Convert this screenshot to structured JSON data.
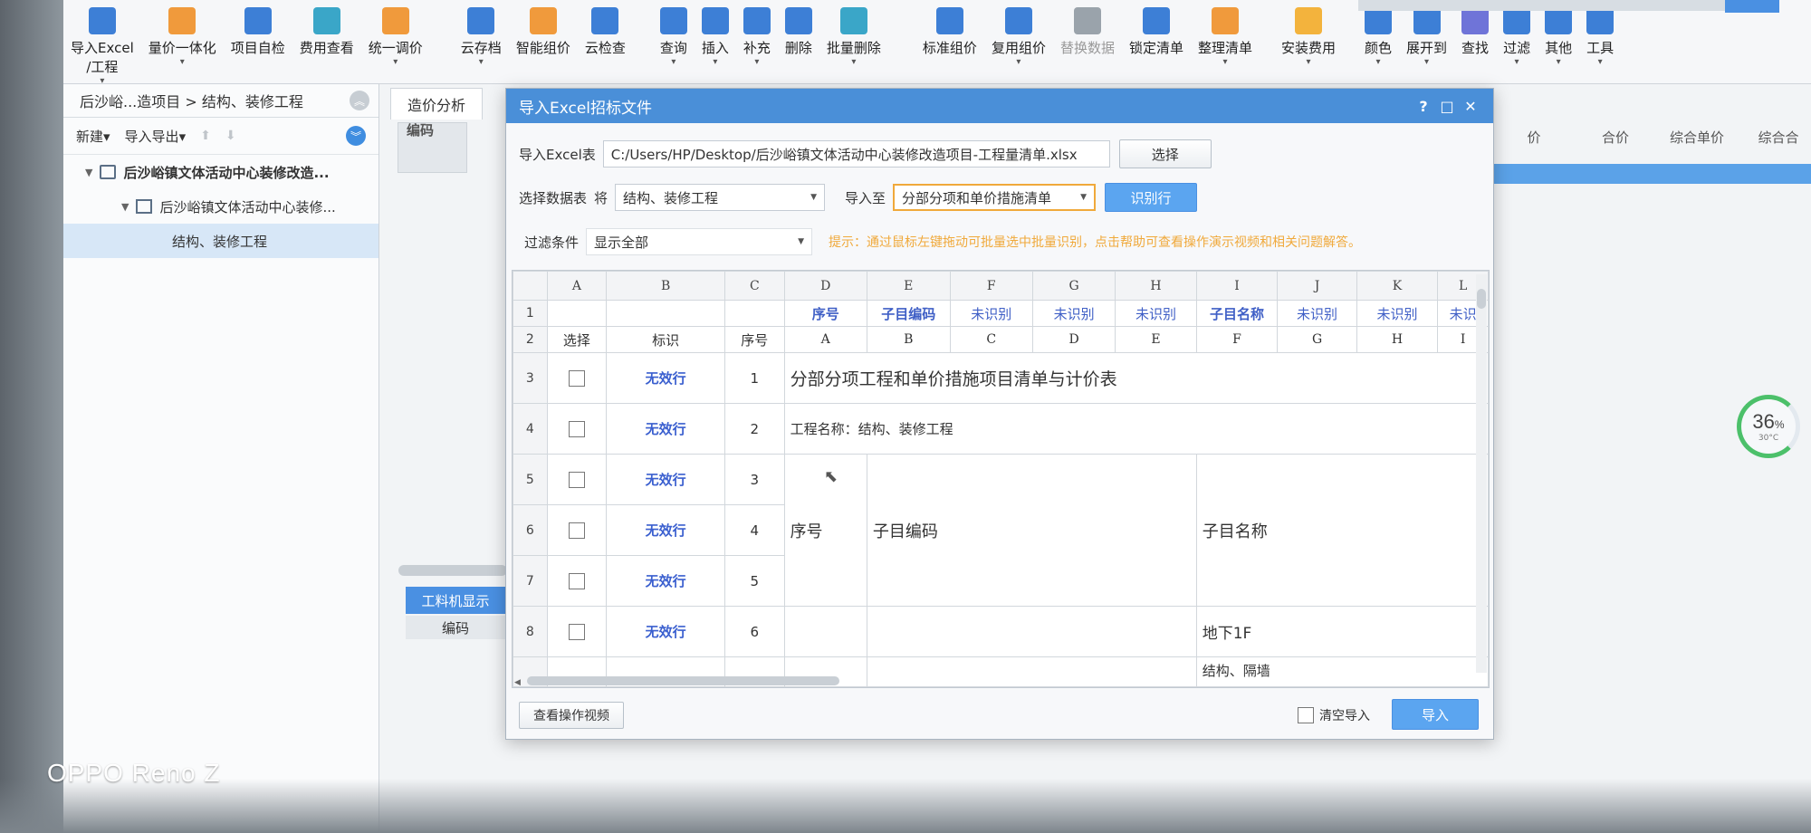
{
  "ribbon": {
    "items": [
      {
        "label": "导入Excel",
        "label2": "/工程",
        "icon": "excel-import-icon",
        "arrow": true
      },
      {
        "label": "量价一体化",
        "icon": "calc-icon",
        "arrow": true
      },
      {
        "label": "项目自检",
        "icon": "check-icon"
      },
      {
        "label": "费用查看",
        "icon": "fee-view-icon"
      },
      {
        "label": "统一调价",
        "icon": "adjust-price-icon",
        "arrow": true
      },
      {
        "label": "云存档",
        "icon": "cloud-save-icon",
        "arrow": true
      },
      {
        "label": "智能组价",
        "icon": "smart-price-icon"
      },
      {
        "label": "云检查",
        "icon": "cloud-check-icon"
      },
      {
        "label": "查询",
        "icon": "query-icon",
        "arrow": true
      },
      {
        "label": "插入",
        "icon": "insert-icon",
        "arrow": true
      },
      {
        "label": "补充",
        "icon": "supplement-icon",
        "arrow": true
      },
      {
        "label": "删除",
        "icon": "delete-icon"
      },
      {
        "label": "批量删除",
        "icon": "batch-delete-icon",
        "arrow": true
      },
      {
        "label": "标准组价",
        "icon": "standard-price-icon"
      },
      {
        "label": "复用组价",
        "icon": "reuse-price-icon",
        "arrow": true
      },
      {
        "label": "替换数据",
        "icon": "replace-data-icon",
        "dim": true
      },
      {
        "label": "锁定清单",
        "icon": "lock-icon"
      },
      {
        "label": "整理清单",
        "icon": "organize-icon",
        "arrow": true
      },
      {
        "label": "安装费用",
        "icon": "install-fee-icon",
        "arrow": true
      },
      {
        "label": "颜色",
        "icon": "color-icon",
        "arrow": true
      },
      {
        "label": "展开到",
        "icon": "expand-icon",
        "arrow": true
      },
      {
        "label": "查找",
        "icon": "find-icon"
      },
      {
        "label": "过滤",
        "icon": "filter-icon",
        "arrow": true
      },
      {
        "label": "其他",
        "icon": "other-icon",
        "arrow": true
      },
      {
        "label": "工具",
        "icon": "tools-icon",
        "arrow": true
      }
    ]
  },
  "left": {
    "breadcrumb": "后沙峪...造项目 > 结构、装修工程",
    "new_label": "新建",
    "import_export_label": "导入导出",
    "tree": [
      {
        "level": 0,
        "text": "后沙峪镇文体活动中心装修改造..."
      },
      {
        "level": 1,
        "text": "后沙峪镇文体活动中心装修..."
      },
      {
        "level": 2,
        "text": "结构、装修工程"
      }
    ]
  },
  "center": {
    "tab": "造价分析",
    "col_header": "编码",
    "right_cols": [
      "价",
      "合价",
      "综合单价",
      "综合合"
    ],
    "bottom_tab_active": "工料机显示",
    "bottom_col": "编码"
  },
  "gauge": {
    "percent": "36",
    "unit": "%",
    "temp": "30°C"
  },
  "dialog": {
    "title": "导入Excel招标文件",
    "controls": {
      "help": "?",
      "max": "□",
      "close": "✕"
    },
    "excel_label": "导入Excel表",
    "excel_path": "C:/Users/HP/Desktop/后沙峪镇文体活动中心装修改造项目-工程量清单.xlsx",
    "choose_button": "选择",
    "sheet_label": "选择数据表",
    "sheet_prefix": "将",
    "sheet_value": "结构、装修工程",
    "import_to_label": "导入至",
    "import_to_value": "分部分项和单价措施清单",
    "identify_button": "识别行",
    "filter_label": "过滤条件",
    "filter_value": "显示全部",
    "hint": "提示：通过鼠标左键拖动可批量选中批量识别，点击帮助可查看操作演示视频和相关问题解答。",
    "grid": {
      "col_letters": [
        "A",
        "B",
        "C",
        "D",
        "E",
        "F",
        "G",
        "H",
        "I",
        "J",
        "K",
        "L"
      ],
      "row1": [
        "",
        "",
        "",
        "序号",
        "子目编码",
        "未识别",
        "未识别",
        "未识别",
        "子目名称",
        "未识别",
        "未识别",
        "未识"
      ],
      "row2": [
        "选择",
        "标识",
        "序号",
        "A",
        "B",
        "C",
        "D",
        "E",
        "F",
        "G",
        "H",
        "I"
      ],
      "rows": [
        {
          "rn": "3",
          "flag": "无效行",
          "seq": "1",
          "text": "分部分项工程和单价措施项目清单与计价表"
        },
        {
          "rn": "4",
          "flag": "无效行",
          "seq": "2",
          "text": "工程名称：结构、装修工程"
        },
        {
          "rn": "5",
          "flag": "无效行",
          "seq": "3"
        },
        {
          "rn": "6",
          "flag": "无效行",
          "seq": "4"
        },
        {
          "rn": "7",
          "flag": "无效行",
          "seq": "5"
        },
        {
          "rn": "8",
          "flag": "无效行",
          "seq": "6"
        }
      ],
      "merged_seq": "序号",
      "merged_code": "子目编码",
      "merged_name": "子目名称",
      "row8_name": "地下1F",
      "row9_name": "结构、隔墙"
    },
    "video_button": "查看操作视频",
    "clear_import_label": "清空导入",
    "import_button": "导入"
  },
  "watermark": "OPPO Reno Z"
}
